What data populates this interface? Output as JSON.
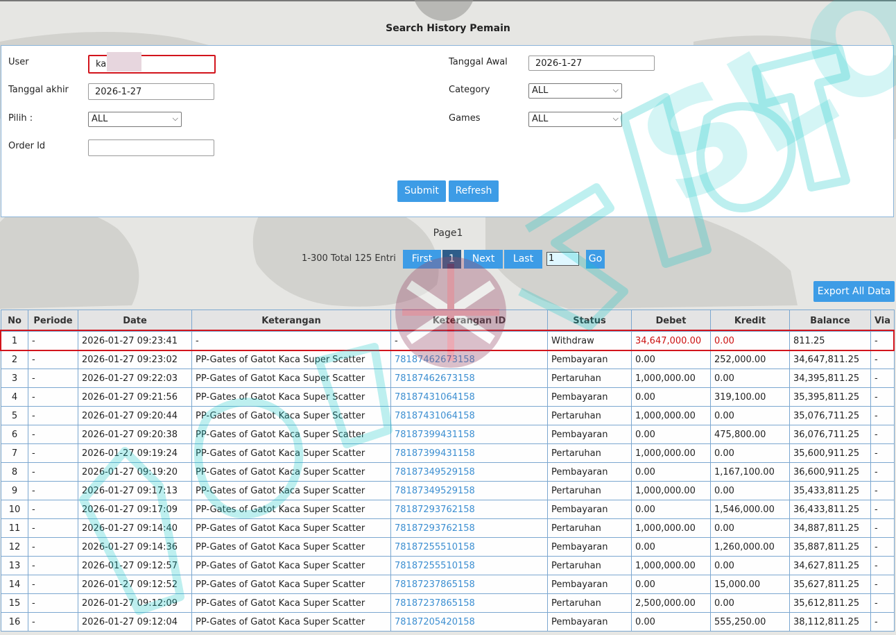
{
  "page": {
    "title": "Search History Pemain"
  },
  "form": {
    "user_label": "User",
    "user_value": "ka",
    "tanggal_awal_label": "Tanggal Awal",
    "tanggal_awal_value": "2026-1-27",
    "tanggal_akhir_label": "Tanggal akhir",
    "tanggal_akhir_value": "2026-1-27",
    "category_label": "Category",
    "category_value": "ALL",
    "pilih_label": "Pilih :",
    "pilih_value": "ALL",
    "games_label": "Games",
    "games_value": "ALL",
    "order_id_label": "Order Id",
    "order_id_value": "",
    "submit_label": "Submit",
    "refresh_label": "Refresh"
  },
  "pagination": {
    "page_label": "Page1",
    "entries_text": "1-300 Total 125 Entri",
    "first_label": "First",
    "current_page": "1",
    "next_label": "Next",
    "last_label": "Last",
    "goto_value": "1",
    "go_label": "Go"
  },
  "export_label": "Export All Data",
  "table": {
    "headers": [
      "No",
      "Periode",
      "Date",
      "Keterangan",
      "Keterangan ID",
      "Status",
      "Debet",
      "Kredit",
      "Balance",
      "Via"
    ],
    "rows": [
      [
        "1",
        "-",
        "2026-01-27 09:23:41",
        "-",
        "-",
        "Withdraw",
        "34,647,000.00",
        "0.00",
        "811.25",
        "-"
      ],
      [
        "2",
        "-",
        "2026-01-27 09:23:02",
        "PP-Gates of Gatot Kaca Super Scatter",
        "78187462673158",
        "Pembayaran",
        "0.00",
        "252,000.00",
        "34,647,811.25",
        "-"
      ],
      [
        "3",
        "-",
        "2026-01-27 09:22:03",
        "PP-Gates of Gatot Kaca Super Scatter",
        "78187462673158",
        "Pertaruhan",
        "1,000,000.00",
        "0.00",
        "34,395,811.25",
        "-"
      ],
      [
        "4",
        "-",
        "2026-01-27 09:21:56",
        "PP-Gates of Gatot Kaca Super Scatter",
        "78187431064158",
        "Pembayaran",
        "0.00",
        "319,100.00",
        "35,395,811.25",
        "-"
      ],
      [
        "5",
        "-",
        "2026-01-27 09:20:44",
        "PP-Gates of Gatot Kaca Super Scatter",
        "78187431064158",
        "Pertaruhan",
        "1,000,000.00",
        "0.00",
        "35,076,711.25",
        "-"
      ],
      [
        "6",
        "-",
        "2026-01-27 09:20:38",
        "PP-Gates of Gatot Kaca Super Scatter",
        "78187399431158",
        "Pembayaran",
        "0.00",
        "475,800.00",
        "36,076,711.25",
        "-"
      ],
      [
        "7",
        "-",
        "2026-01-27 09:19:24",
        "PP-Gates of Gatot Kaca Super Scatter",
        "78187399431158",
        "Pertaruhan",
        "1,000,000.00",
        "0.00",
        "35,600,911.25",
        "-"
      ],
      [
        "8",
        "-",
        "2026-01-27 09:19:20",
        "PP-Gates of Gatot Kaca Super Scatter",
        "78187349529158",
        "Pembayaran",
        "0.00",
        "1,167,100.00",
        "36,600,911.25",
        "-"
      ],
      [
        "9",
        "-",
        "2026-01-27 09:17:13",
        "PP-Gates of Gatot Kaca Super Scatter",
        "78187349529158",
        "Pertaruhan",
        "1,000,000.00",
        "0.00",
        "35,433,811.25",
        "-"
      ],
      [
        "10",
        "-",
        "2026-01-27 09:17:09",
        "PP-Gates of Gatot Kaca Super Scatter",
        "78187293762158",
        "Pembayaran",
        "0.00",
        "1,546,000.00",
        "36,433,811.25",
        "-"
      ],
      [
        "11",
        "-",
        "2026-01-27 09:14:40",
        "PP-Gates of Gatot Kaca Super Scatter",
        "78187293762158",
        "Pertaruhan",
        "1,000,000.00",
        "0.00",
        "34,887,811.25",
        "-"
      ],
      [
        "12",
        "-",
        "2026-01-27 09:14:36",
        "PP-Gates of Gatot Kaca Super Scatter",
        "78187255510158",
        "Pembayaran",
        "0.00",
        "1,260,000.00",
        "35,887,811.25",
        "-"
      ],
      [
        "13",
        "-",
        "2026-01-27 09:12:57",
        "PP-Gates of Gatot Kaca Super Scatter",
        "78187255510158",
        "Pertaruhan",
        "1,000,000.00",
        "0.00",
        "34,627,811.25",
        "-"
      ],
      [
        "14",
        "-",
        "2026-01-27 09:12:52",
        "PP-Gates of Gatot Kaca Super Scatter",
        "78187237865158",
        "Pembayaran",
        "0.00",
        "15,000.00",
        "35,627,811.25",
        "-"
      ],
      [
        "15",
        "-",
        "2026-01-27 09:12:09",
        "PP-Gates of Gatot Kaca Super Scatter",
        "78187237865158",
        "Pertaruhan",
        "2,500,000.00",
        "0.00",
        "35,612,811.25",
        "-"
      ],
      [
        "16",
        "-",
        "2026-01-27 09:12:04",
        "PP-Gates of Gatot Kaca Super Scatter",
        "78187205420158",
        "Pembayaran",
        "0.00",
        "555,250.00",
        "38,112,811.25",
        "-"
      ]
    ]
  },
  "colors": {
    "accent": "#3d9ce6",
    "active_page": "#2e5d8a",
    "highlight": "#d2141c",
    "link": "#3d8fd1",
    "negative": "#cc1111"
  },
  "watermark_text": "SLOT"
}
